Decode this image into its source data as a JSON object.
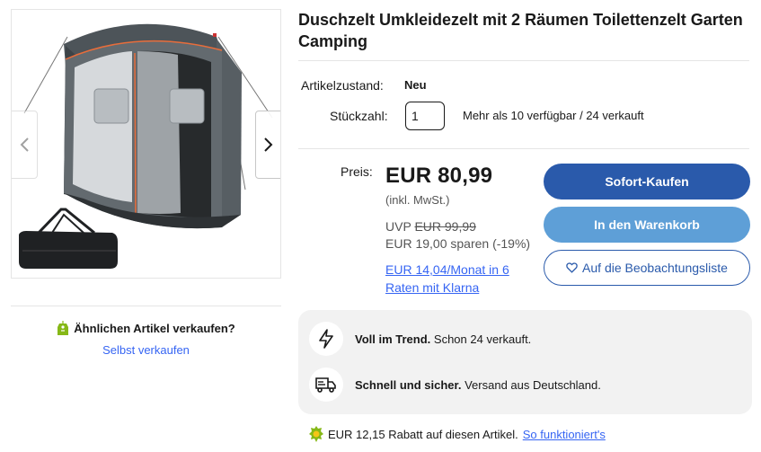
{
  "product": {
    "title": "Duschzelt Umkleidezelt mit 2 Räumen Toilettenzelt Garten Camping",
    "image_alt": "Product photo of a grey two-room shower tent with black carry bag"
  },
  "carousel": {
    "prev_icon": "chevron-left-icon",
    "next_icon": "chevron-right-icon"
  },
  "details": {
    "condition_label": "Artikelzustand:",
    "condition_value": "Neu",
    "quantity_label": "Stückzahl:",
    "quantity_value": "1",
    "availability": "Mehr als 10 verfügbar / 24 verkauft"
  },
  "pricing": {
    "price_label": "Preis:",
    "price": "EUR 80,99",
    "tax_note": "(inkl. MwSt.)",
    "uvp_label": "UVP",
    "uvp_price": "EUR 99,99",
    "savings": "EUR 19,00 sparen (-19%)",
    "installment_link": "EUR 14,04/Monat in 6 Raten mit Klarna"
  },
  "actions": {
    "buy_now": "Sofort-Kaufen",
    "add_to_cart": "In den Warenkorb",
    "watchlist": "Auf die Beobachtungsliste"
  },
  "sell": {
    "title": "Ähnlichen Artikel verkaufen?",
    "link": "Selbst verkaufen"
  },
  "highlights": [
    {
      "icon": "lightning-icon",
      "bold": "Voll im Trend.",
      "text": " Schon 24 verkauft."
    },
    {
      "icon": "truck-icon",
      "bold": "Schnell und sicher.",
      "text": " Versand aus Deutschland."
    }
  ],
  "discount": {
    "text": "EUR 12,15 Rabatt auf diesen Artikel.",
    "link": "So funktioniert's"
  },
  "colors": {
    "primary_button": "#2a5aab",
    "secondary_button": "#5e9fd7",
    "link": "#3665f3"
  }
}
